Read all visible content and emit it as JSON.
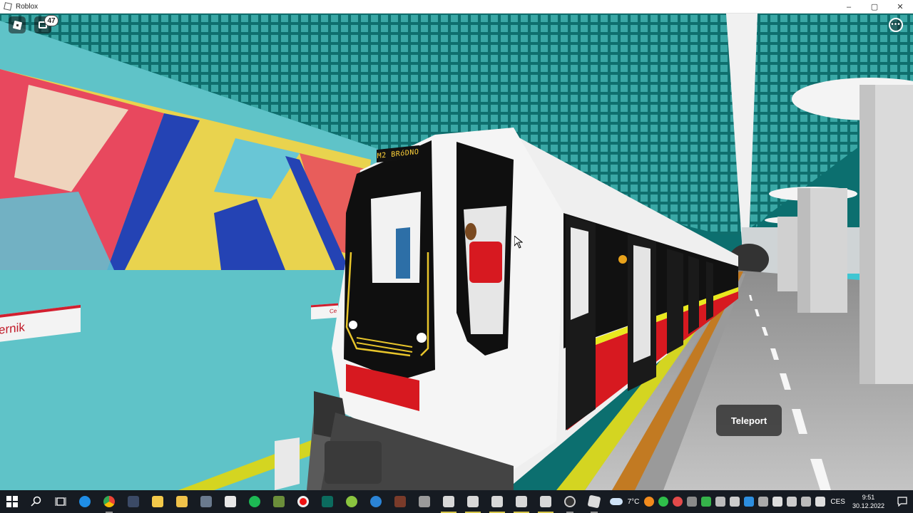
{
  "window": {
    "title": "Roblox",
    "controls": {
      "minimize": "–",
      "maximize": "▢",
      "close": "✕"
    }
  },
  "game": {
    "chat_badge_count": "47",
    "more_menu": "•••",
    "teleport_button": "Teleport",
    "station_sign": "ernik",
    "station_sign_small": "Ce",
    "train_destination": "M2 BRóDNO"
  },
  "colors": {
    "wall_teal": "#5fc3c8",
    "ceiling_teal": "#14807f",
    "train_red": "#d71920",
    "platform_yellow": "#d4d521",
    "taskbar_bg": "#161b22"
  },
  "taskbar": {
    "apps": [
      {
        "name": "start-icon"
      },
      {
        "name": "search-icon"
      },
      {
        "name": "task-view-icon"
      },
      {
        "name": "edge-icon"
      },
      {
        "name": "chrome-icon"
      },
      {
        "name": "calculator-icon"
      },
      {
        "name": "folder-icon"
      },
      {
        "name": "folder-icon"
      },
      {
        "name": "calculator-icon"
      },
      {
        "name": "store-icon"
      },
      {
        "name": "spotify-icon"
      },
      {
        "name": "minecraft-icon"
      },
      {
        "name": "record-icon"
      },
      {
        "name": "app-icon"
      },
      {
        "name": "app-icon"
      },
      {
        "name": "app-icon"
      },
      {
        "name": "app-icon"
      },
      {
        "name": "app-icon"
      },
      {
        "name": "train-app-icon"
      },
      {
        "name": "train-app-icon"
      },
      {
        "name": "train-app-icon"
      },
      {
        "name": "train-app-icon"
      },
      {
        "name": "train-app-icon"
      },
      {
        "name": "app-icon"
      },
      {
        "name": "roblox-icon"
      }
    ],
    "weather": "7°C",
    "language": "CES",
    "time": "9:51",
    "date": "30.12.2022"
  }
}
